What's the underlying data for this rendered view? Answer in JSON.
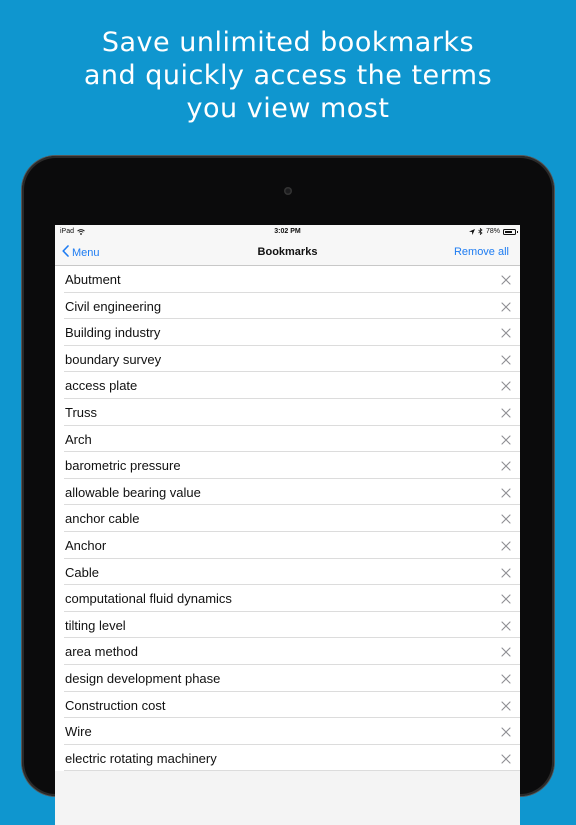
{
  "colors": {
    "background": "#0f96cf",
    "accent": "#1e7cf2"
  },
  "headline": {
    "line1": "Save unlimited bookmarks",
    "line2": "and quickly access the terms",
    "line3": "you view most"
  },
  "statusbar": {
    "device": "iPad",
    "time": "3:02 PM",
    "battery": "78%",
    "battery_level": 0.78,
    "icons": [
      "wifi-icon",
      "location-icon",
      "bluetooth-icon",
      "battery-icon"
    ]
  },
  "navbar": {
    "back_label": "Menu",
    "title": "Bookmarks",
    "remove_all_label": "Remove all"
  },
  "bookmarks": [
    "Abutment",
    "Civil engineering",
    "Building industry",
    "boundary survey",
    "access plate",
    "Truss",
    "Arch",
    "barometric pressure",
    "allowable bearing value",
    "anchor cable",
    "Anchor",
    "Cable",
    "computational fluid dynamics",
    "tilting level",
    "area method",
    "design development phase",
    "Construction cost",
    "Wire",
    "electric rotating machinery"
  ]
}
